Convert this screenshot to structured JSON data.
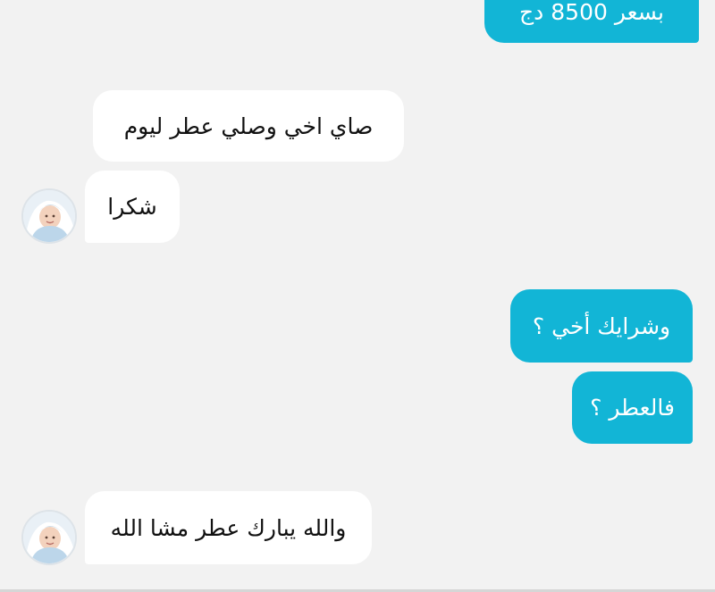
{
  "chat": {
    "messages": [
      {
        "direction": "outgoing",
        "text": "بسعر 8500 دج"
      },
      {
        "direction": "incoming",
        "text": "صاي اخي وصلي عطر ليوم"
      },
      {
        "direction": "incoming",
        "text": "شكرا"
      },
      {
        "direction": "outgoing",
        "text": "وشرايك أخي ؟"
      },
      {
        "direction": "outgoing",
        "text": "فالعطر ؟"
      },
      {
        "direction": "incoming",
        "text": "والله يبارك  عطر مشا الله"
      }
    ]
  },
  "colors": {
    "background": "#f2f2f2",
    "outgoing_bubble": "#12b5d6",
    "incoming_bubble": "#ffffff"
  },
  "icons": {
    "contact_avatar": "baby-photo-avatar"
  }
}
